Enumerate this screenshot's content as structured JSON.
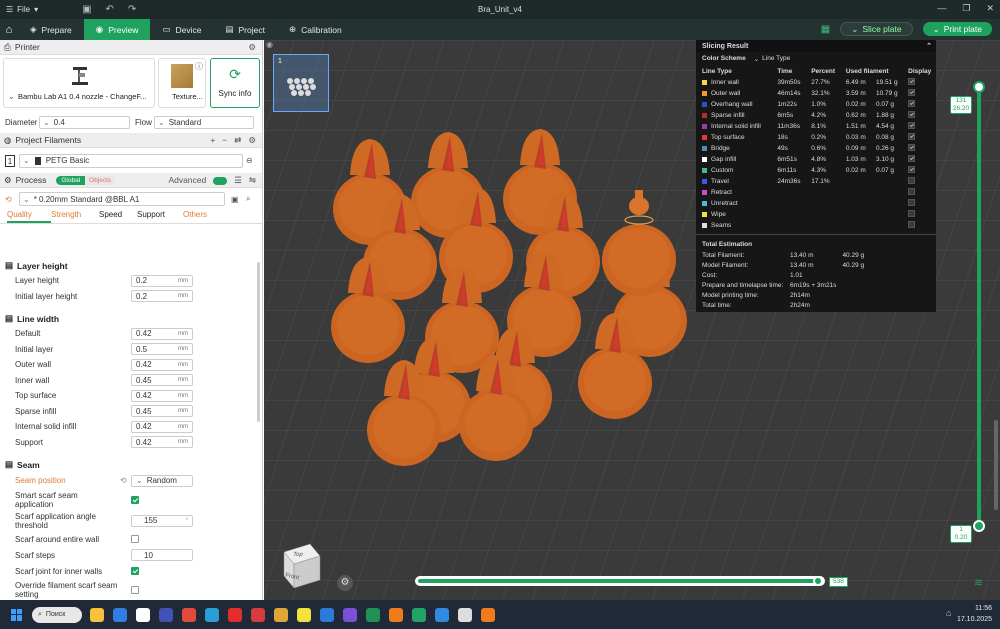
{
  "titlebar": {
    "menu": "File",
    "title": "Bra_Unit_v4"
  },
  "toolbar": {
    "tabs": [
      {
        "label": "Prepare"
      },
      {
        "label": "Preview"
      },
      {
        "label": "Device"
      },
      {
        "label": "Project"
      },
      {
        "label": "Calibration"
      }
    ],
    "slice_plate": "Slice plate",
    "print_plate": "Print plate"
  },
  "printer": {
    "section_title": "Printer",
    "name": "Bambu Lab A1 0.4 nozzle - ChangeF...",
    "plate": "Texture...",
    "sync": "Sync info",
    "diameter_label": "Diameter",
    "diameter_value": "0.4",
    "flow_label": "Flow",
    "flow_value": "Standard"
  },
  "filaments": {
    "section_title": "Project Filaments",
    "index": "1",
    "name": "PETG Basic"
  },
  "process": {
    "section_title": "Process",
    "toggle_global": "Global",
    "toggle_objects": "Objects",
    "advanced": "Advanced",
    "preset": "* 0.20mm Standard @BBL A1",
    "tabs": [
      "Quality",
      "Strength",
      "Speed",
      "Support",
      "Others"
    ]
  },
  "layer_height": {
    "title": "Layer height",
    "rows": [
      {
        "label": "Layer height",
        "value": "0.2",
        "unit": "mm"
      },
      {
        "label": "Initial layer height",
        "value": "0.2",
        "unit": "mm"
      }
    ]
  },
  "line_width": {
    "title": "Line width",
    "rows": [
      {
        "label": "Default",
        "value": "0.42",
        "unit": "mm"
      },
      {
        "label": "Initial layer",
        "value": "0.5",
        "unit": "mm"
      },
      {
        "label": "Outer wall",
        "value": "0.42",
        "unit": "mm"
      },
      {
        "label": "Inner wall",
        "value": "0.45",
        "unit": "mm"
      },
      {
        "label": "Top surface",
        "value": "0.42",
        "unit": "mm"
      },
      {
        "label": "Sparse infill",
        "value": "0.45",
        "unit": "mm"
      },
      {
        "label": "Internal solid infill",
        "value": "0.42",
        "unit": "mm"
      },
      {
        "label": "Support",
        "value": "0.42",
        "unit": "mm"
      }
    ]
  },
  "seam": {
    "title": "Seam",
    "position_label": "Seam position",
    "position_value": "Random",
    "smart_scarf": "Smart scarf seam application",
    "angle_label": "Scarf application angle threshold",
    "angle_value": "155",
    "angle_unit": "°",
    "around_wall": "Scarf around entire wall",
    "steps_label": "Scarf steps",
    "steps_value": "10",
    "inner_walls": "Scarf joint for inner walls",
    "override": "Override filament scarf seam setting"
  },
  "viewport": {
    "plate_number": "1",
    "top_slider_top": "131",
    "top_slider_height": "26.20",
    "bottom_slider_layer": "1",
    "bottom_slider_height": "0.20",
    "horizontal_value": "538",
    "view_top": "Top",
    "view_front": "Front"
  },
  "slicing_result": {
    "title": "Slicing Result",
    "color_scheme_label": "Color Scheme",
    "color_scheme_value": "Line Type",
    "headers": [
      "Line Type",
      "Time",
      "Percent",
      "Used filament",
      "Display"
    ],
    "rows": [
      {
        "type": "Inner wall",
        "color": "#f5d54a",
        "time": "39m50s",
        "percent": "27.7%",
        "len": "6.49 m",
        "weight": "19.51 g",
        "display": true
      },
      {
        "type": "Outer wall",
        "color": "#f29a2a",
        "time": "46m14s",
        "percent": "32.1%",
        "len": "3.59 m",
        "weight": "10.79 g",
        "display": true
      },
      {
        "type": "Overhang wall",
        "color": "#2e4fc8",
        "time": "1m22s",
        "percent": "1.0%",
        "len": "0.02 m",
        "weight": "0.07 g",
        "display": true
      },
      {
        "type": "Sparse infill",
        "color": "#b03030",
        "time": "6m5s",
        "percent": "4.2%",
        "len": "0.62 m",
        "weight": "1.88 g",
        "display": true
      },
      {
        "type": "Internal solid infill",
        "color": "#9b3bb0",
        "time": "11m36s",
        "percent": "8.1%",
        "len": "1.51 m",
        "weight": "4.54 g",
        "display": true
      },
      {
        "type": "Top surface",
        "color": "#e03a3a",
        "time": "18s",
        "percent": "0.2%",
        "len": "0.03 m",
        "weight": "0.08 g",
        "display": true
      },
      {
        "type": "Bridge",
        "color": "#4d8fb0",
        "time": "49s",
        "percent": "0.6%",
        "len": "0.09 m",
        "weight": "0.26 g",
        "display": true
      },
      {
        "type": "Gap infill",
        "color": "#ffffff",
        "time": "6m51s",
        "percent": "4.8%",
        "len": "1.03 m",
        "weight": "3.10 g",
        "display": true
      },
      {
        "type": "Custom",
        "color": "#3fbf7f",
        "time": "6m11s",
        "percent": "4.3%",
        "len": "0.02 m",
        "weight": "0.07 g",
        "display": true
      },
      {
        "type": "Travel",
        "color": "#3a5adf",
        "time": "24m36s",
        "percent": "17.1%",
        "len": "",
        "weight": "",
        "display": false
      },
      {
        "type": "Retract",
        "color": "#d04ad0",
        "time": "",
        "percent": "",
        "len": "",
        "weight": "",
        "display": false
      },
      {
        "type": "Unretract",
        "color": "#40c0d0",
        "time": "",
        "percent": "",
        "len": "",
        "weight": "",
        "display": false
      },
      {
        "type": "Wipe",
        "color": "#f0e040",
        "time": "",
        "percent": "",
        "len": "",
        "weight": "",
        "display": false
      },
      {
        "type": "Seams",
        "color": "#e0e0e0",
        "time": "",
        "percent": "",
        "len": "",
        "weight": "",
        "display": false
      }
    ],
    "total_title": "Total Estimation",
    "totals": [
      {
        "label": "Total Filament:",
        "v1": "13.40 m",
        "v2": "40.29 g"
      },
      {
        "label": "Model Filament:",
        "v1": "13.40 m",
        "v2": "40.29 g"
      },
      {
        "label": "Cost:",
        "v1": "1.01",
        "v2": ""
      },
      {
        "label": "Prepare and timelapse time:",
        "v1": "6m19s + 3m21s",
        "v2": ""
      },
      {
        "label": "Model printing time:",
        "v1": "2h14m",
        "v2": ""
      },
      {
        "label": "Total time:",
        "v1": "2h24m",
        "v2": ""
      }
    ]
  },
  "taskbar": {
    "search": "Поиск",
    "time": "11:56",
    "date": "17.10.2025",
    "apps": [
      "#f9c23c",
      "#2f7de1",
      "#ffffff",
      "#4052b5",
      "#e24a3b",
      "#2a9fd6",
      "#e52d2d",
      "#d83b3b",
      "#e0a63a",
      "#f3e23c",
      "#2d7ad9",
      "#7b4fd6",
      "#1f9254",
      "#f07b1b",
      "#21a366",
      "#2f8be0",
      "#dddddd",
      "#f07b1b"
    ]
  }
}
